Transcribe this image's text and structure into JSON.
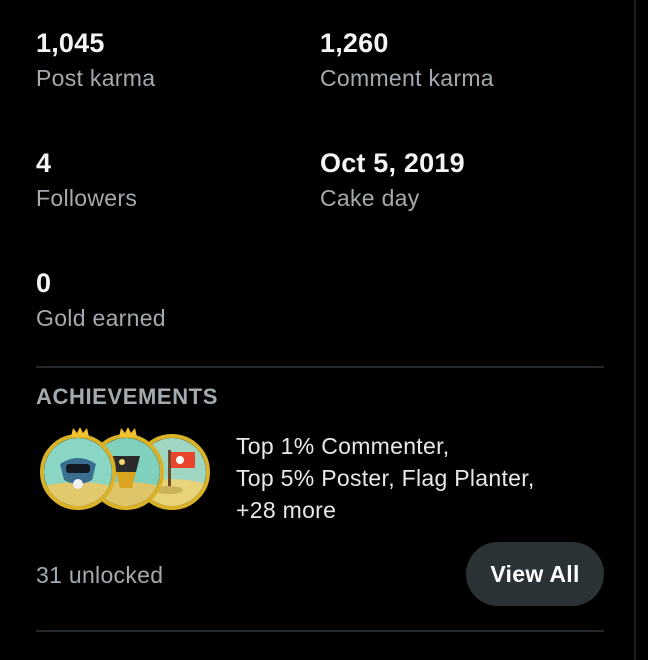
{
  "stats": {
    "post_karma": {
      "value": "1,045",
      "label": "Post karma"
    },
    "comment_karma": {
      "value": "1,260",
      "label": "Comment karma"
    },
    "followers": {
      "value": "4",
      "label": "Followers"
    },
    "cake_day": {
      "value": "Oct 5, 2019",
      "label": "Cake day"
    },
    "gold": {
      "value": "0",
      "label": "Gold earned"
    }
  },
  "achievements": {
    "title": "ACHIEVEMENTS",
    "summary_lines": [
      "Top 1% Commenter,",
      "Top 5% Poster, Flag Planter,",
      "+28 more"
    ],
    "unlocked": "31 unlocked",
    "view_all_label": "View All",
    "badges": [
      "top-commenter-badge-icon",
      "top-poster-badge-icon",
      "flag-planter-badge-icon"
    ]
  },
  "colors": {
    "background": "#000000",
    "label_gray": "#a4abb0",
    "button_bg": "#2a3236",
    "badge_gold": "#d9b228"
  }
}
